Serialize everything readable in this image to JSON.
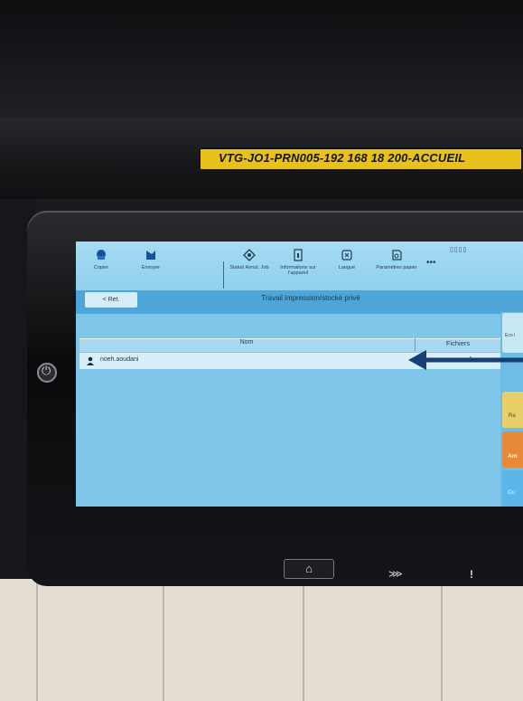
{
  "device": {
    "printer_label": "VTG-JO1-PRN005-192 168 18 200-ACCUEIL"
  },
  "toolbar": {
    "items": [
      {
        "label": "Copier",
        "icon": "copy-icon"
      },
      {
        "label": "Envoyer",
        "icon": "send-icon"
      },
      {
        "label": "Statut/ Annul. Job",
        "icon": "status-icon"
      },
      {
        "label": "Informations sur l'appareil",
        "icon": "info-icon"
      },
      {
        "label": "Langue",
        "icon": "language-icon"
      },
      {
        "label": "Paramètres papier",
        "icon": "paper-settings-icon"
      }
    ],
    "more": "•••",
    "status_indicator": "▯▯▯▯"
  },
  "nav": {
    "back_label": "< Ret.",
    "title": "Travail impression/stocké privé"
  },
  "table": {
    "columns": [
      "Nom",
      "Fichiers"
    ],
    "rows": [
      {
        "name": "noeh.aoudani",
        "files": "1"
      }
    ]
  },
  "side_buttons": [
    {
      "label": "Eco i",
      "color": "#c9e8f6"
    },
    {
      "label": "Ra",
      "color": "#e9cf6a"
    },
    {
      "label": "Am",
      "color": "#e8893a"
    },
    {
      "label": "Ou",
      "color": "#5ab6e7"
    }
  ],
  "bottom_controls": {
    "home_icon": "⌂",
    "symbol_1": "⋙",
    "symbol_2": "!"
  },
  "colors": {
    "screen_bg": "#7fc6ea",
    "nav_bar": "#4ea5d7",
    "label_yellow": "#e8c21a",
    "annotation_arrow": "#163f75"
  }
}
